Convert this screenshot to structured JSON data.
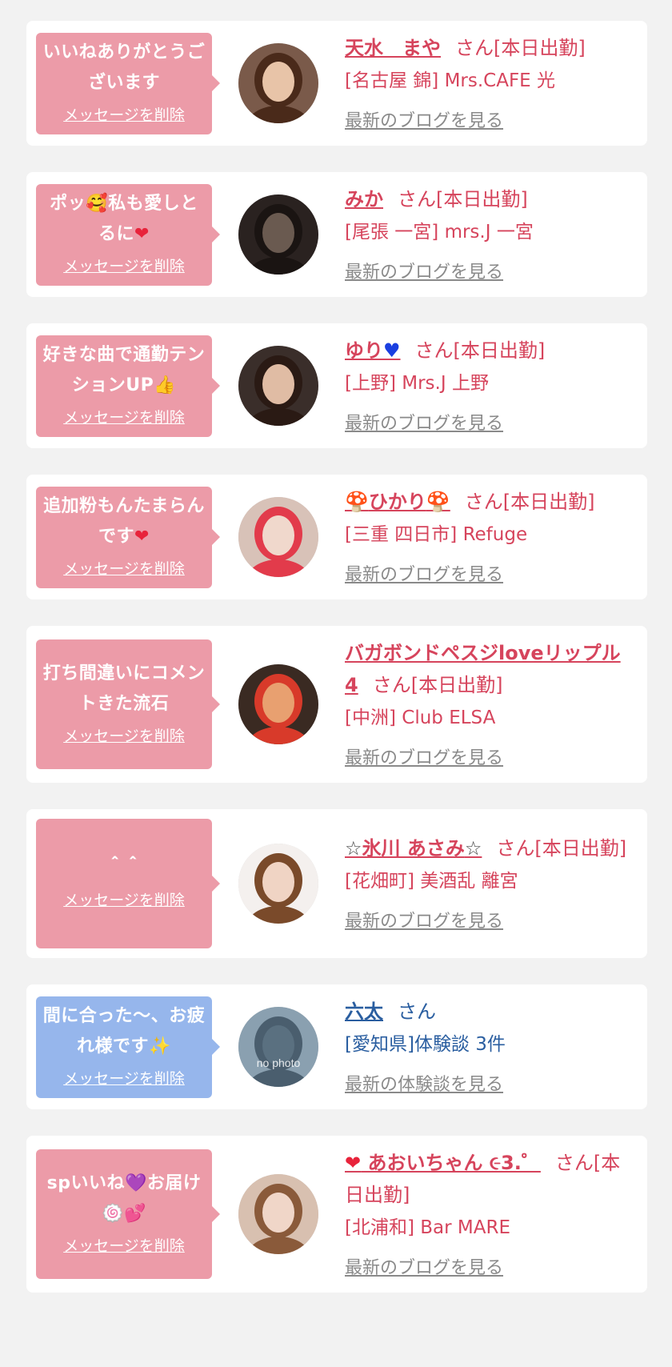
{
  "delete_label": "メッセージを削除",
  "items": [
    {
      "type": "pink",
      "bubble": [
        {
          "t": "いいねありがとうございます"
        }
      ],
      "name_parts": [
        {
          "t": "天水　まや"
        }
      ],
      "san": "さん[本日出勤]",
      "shop": "[名古屋 錦] Mrs.CAFE 光",
      "link": "最新のブログを見る"
    },
    {
      "type": "pink",
      "bubble": [
        {
          "t": "ポッ"
        },
        {
          "e": "🥰",
          "c": "emoji-blush"
        },
        {
          "t": "私も愛しとるに"
        },
        {
          "e": "❤",
          "c": "emoji-heart"
        }
      ],
      "name_parts": [
        {
          "t": "みか"
        }
      ],
      "san": "さん[本日出勤]",
      "shop": "[尾張 一宮] mrs.J 一宮",
      "link": "最新のブログを見る"
    },
    {
      "type": "pink",
      "bubble": [
        {
          "t": "好きな曲で通勤テンションUP"
        },
        {
          "e": "👍",
          "c": "emoji-thumb"
        }
      ],
      "name_parts": [
        {
          "t": "ゆり"
        },
        {
          "e": "♥",
          "c": "emoji-blue-heart"
        }
      ],
      "san": "さん[本日出勤]",
      "shop": "[上野] Mrs.J 上野",
      "link": "最新のブログを見る"
    },
    {
      "type": "pink",
      "bubble": [
        {
          "t": "追加粉もんたまらんです"
        },
        {
          "e": "❤",
          "c": "emoji-heart"
        }
      ],
      "name_parts": [
        {
          "e": "🍄",
          "c": "emoji-mush"
        },
        {
          "t": "ひかり"
        },
        {
          "e": "🍄",
          "c": "emoji-mush"
        }
      ],
      "san": "さん[本日出勤]",
      "shop": "[三重 四日市] Refuge",
      "link": "最新のブログを見る"
    },
    {
      "type": "pink",
      "bubble": [
        {
          "t": "打ち間違いにコメントきた流石"
        }
      ],
      "name_parts": [
        {
          "t": "バガボンドペスジloveリップル4"
        }
      ],
      "san": "さん[本日出勤]",
      "shop": "[中洲] Club ELSA",
      "link": "最新のブログを見る"
    },
    {
      "type": "pink",
      "bubble": [
        {
          "t": "＾＾"
        }
      ],
      "name_parts": [
        {
          "e": "☆",
          "c": "emoji-star"
        },
        {
          "t": "氷川 あさみ"
        },
        {
          "e": "☆",
          "c": "emoji-star"
        }
      ],
      "san": "さん[本日出勤]",
      "shop": "[花畑町] 美酒乱 離宮",
      "link": "最新のブログを見る"
    },
    {
      "type": "blue",
      "bubble": [
        {
          "t": "間に合った〜、お疲れ様です"
        },
        {
          "e": "✨",
          "c": "emoji-spark"
        }
      ],
      "name_parts": [
        {
          "t": "六太"
        }
      ],
      "san": "さん",
      "shop": "[愛知県]体験談 3件",
      "link": "最新の体験談を見る",
      "avatar_text": "no photo"
    },
    {
      "type": "pink",
      "bubble": [
        {
          "t": "spいいね"
        },
        {
          "e": "💜",
          "c": "emoji-purple"
        },
        {
          "t": "お届け"
        },
        {
          "e": "🍥",
          "c": "emoji-purple"
        },
        {
          "e": "💕",
          "c": "emoji-heart"
        }
      ],
      "name_parts": [
        {
          "e": "❤",
          "c": "emoji-heart"
        },
        {
          "t": " あおいちゃん ૯3.゜"
        }
      ],
      "san": "さん[本日出勤]",
      "shop": "[北浦和] Bar MARE",
      "link": "最新のブログを見る"
    }
  ],
  "avatars": [
    {
      "bg": "#7a5a4a",
      "fg": "#e8c4a8",
      "hair": "#4a2a1a"
    },
    {
      "bg": "#2a2220",
      "fg": "#6a5a50",
      "hair": "#1a1412"
    },
    {
      "bg": "#3a2e2a",
      "fg": "#e0bca4",
      "hair": "#2a1a14"
    },
    {
      "bg": "#d8c2b8",
      "fg": "#f0d8cc",
      "hair": "#e23b4b"
    },
    {
      "bg": "#3a2a22",
      "fg": "#e8a070",
      "hair": "#d83a2a"
    },
    {
      "bg": "#f4f0ee",
      "fg": "#f0d4c4",
      "hair": "#7a4a2a"
    },
    {
      "bg": "#8aa0b0",
      "fg": "#5a7080",
      "hair": "#4a5e6e"
    },
    {
      "bg": "#d8c0b0",
      "fg": "#f0d6c8",
      "hair": "#8a5a3a"
    }
  ]
}
